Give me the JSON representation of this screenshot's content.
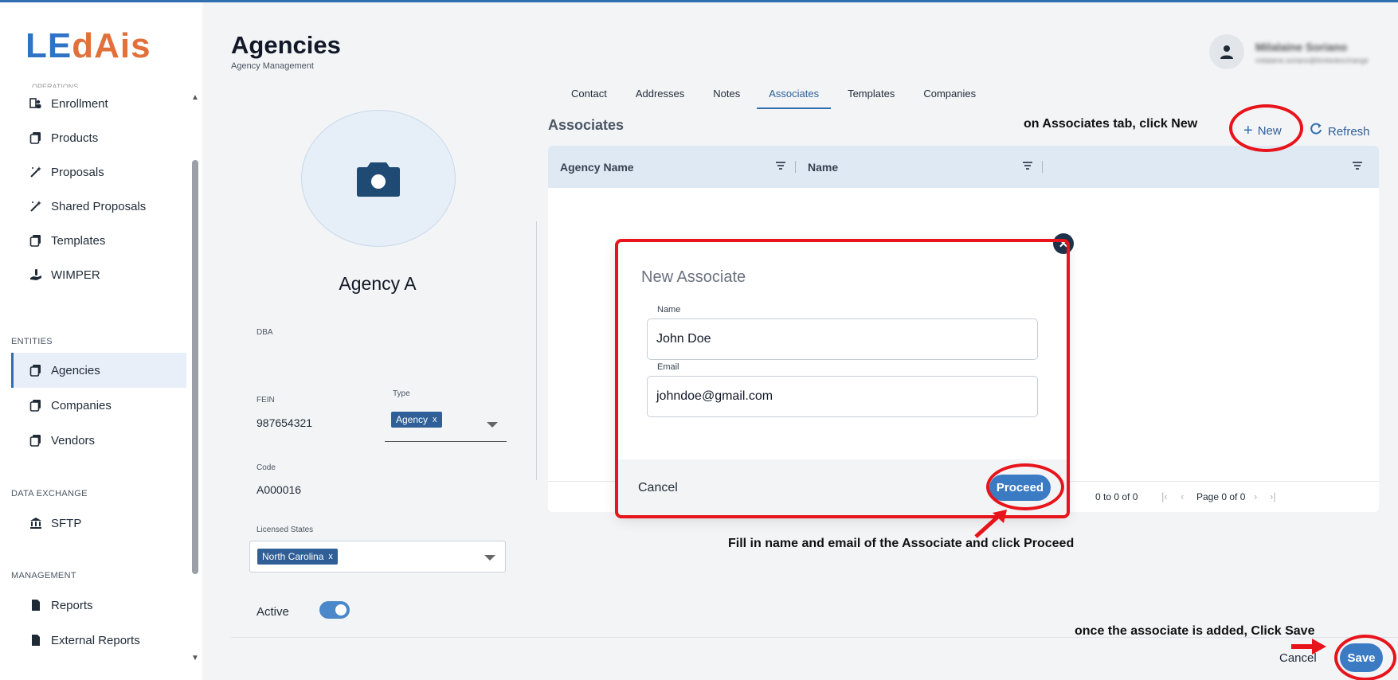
{
  "app": {
    "logo_part1": "LE",
    "logo_part2": "dAis",
    "cut_label": "OPERATIONS"
  },
  "sidebar": {
    "items_top": [
      {
        "label": "Enrollment",
        "icon": "enrollment-icon"
      },
      {
        "label": "Products",
        "icon": "products-icon"
      },
      {
        "label": "Proposals",
        "icon": "magic-wand-icon"
      },
      {
        "label": "Shared Proposals",
        "icon": "magic-wand-icon"
      },
      {
        "label": "Templates",
        "icon": "templates-icon"
      },
      {
        "label": "WIMPER",
        "icon": "hand-icon"
      }
    ],
    "entities_label": "ENTITIES",
    "entities": [
      {
        "label": "Agencies",
        "icon": "agencies-icon"
      },
      {
        "label": "Companies",
        "icon": "companies-icon"
      },
      {
        "label": "Vendors",
        "icon": "vendors-icon"
      }
    ],
    "data_exchange_label": "DATA EXCHANGE",
    "data_exchange": [
      {
        "label": "SFTP",
        "icon": "bank-icon"
      }
    ],
    "management_label": "MANAGEMENT",
    "management": [
      {
        "label": "Reports",
        "icon": "document-icon"
      },
      {
        "label": "External Reports",
        "icon": "document-icon"
      }
    ]
  },
  "header": {
    "title": "Agencies",
    "subtitle": "Agency Management",
    "user_name": "Milalaine Soriano",
    "user_email": "milalaine.soriano@limitedexchange"
  },
  "profile": {
    "agency_name": "Agency A",
    "dba_label": "DBA",
    "fein_label": "FEIN",
    "fein_value": "987654321",
    "type_label": "Type",
    "type_chip": "Agency",
    "chip_remove": "x",
    "code_label": "Code",
    "code_value": "A000016",
    "states_label": "Licensed States",
    "states_chip": "North Carolina",
    "active_label": "Active",
    "active_on": true
  },
  "tabs": [
    "Contact",
    "Addresses",
    "Notes",
    "Associates",
    "Templates",
    "Companies"
  ],
  "active_tab": "Associates",
  "associates": {
    "title": "Associates",
    "new_label": "New",
    "refresh_label": "Refresh",
    "columns": [
      "Agency Name",
      "Name",
      ""
    ],
    "pagination": {
      "range": "0 to 0 of 0",
      "page": "Page 0 of 0"
    }
  },
  "modal": {
    "title": "New Associate",
    "name_label": "Name",
    "name_value": "John Doe",
    "email_label": "Email",
    "email_value": "johndoe@gmail.com",
    "cancel_label": "Cancel",
    "proceed_label": "Proceed"
  },
  "footer_actions": {
    "cancel_label": "Cancel",
    "save_label": "Save"
  },
  "annotations": {
    "new_hint": "on Associates tab, click New",
    "proceed_hint": "Fill in name and email of the Associate and click Proceed",
    "save_hint": "once the associate is added, Click Save"
  },
  "colors": {
    "primary": "#2f6fb0",
    "annotation_red": "#e8141b",
    "logo_blue": "#2f74c4",
    "logo_orange": "#e1703a"
  }
}
